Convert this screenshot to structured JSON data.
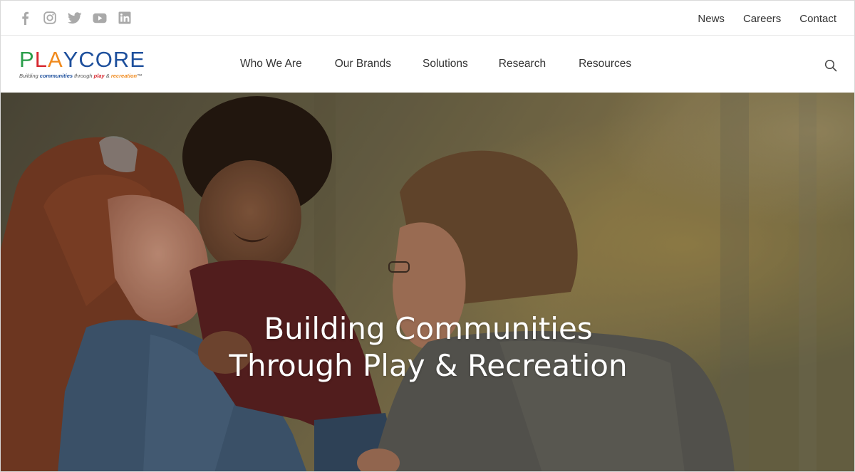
{
  "social": {
    "icons": [
      "facebook-icon",
      "instagram-icon",
      "twitter-icon",
      "youtube-icon",
      "linkedin-icon"
    ],
    "icon_color": "#a9a9a9"
  },
  "utility_nav": {
    "news": "News",
    "careers": "Careers",
    "contact": "Contact"
  },
  "logo": {
    "letters": [
      "P",
      "L",
      "A",
      "Y",
      "C",
      "O",
      "R",
      "E"
    ],
    "letter_colors": [
      "#2a9d4a",
      "#d7282f",
      "#f08a1d",
      "#1d4f9c",
      "#1d4f9c",
      "#1d4f9c",
      "#1d4f9c",
      "#1d4f9c"
    ],
    "tagline_parts": {
      "a": "Building ",
      "b": "communities",
      "c": " through ",
      "d": "play",
      "e": " & ",
      "f": "recreation",
      "g": "™"
    }
  },
  "main_nav": {
    "who_we_are": "Who We Are",
    "our_brands": "Our Brands",
    "solutions": "Solutions",
    "research": "Research",
    "resources": "Resources"
  },
  "search": {
    "icon": "search-icon"
  },
  "hero": {
    "line1": "Building Communities",
    "line2": "Through Play & Recreation"
  }
}
